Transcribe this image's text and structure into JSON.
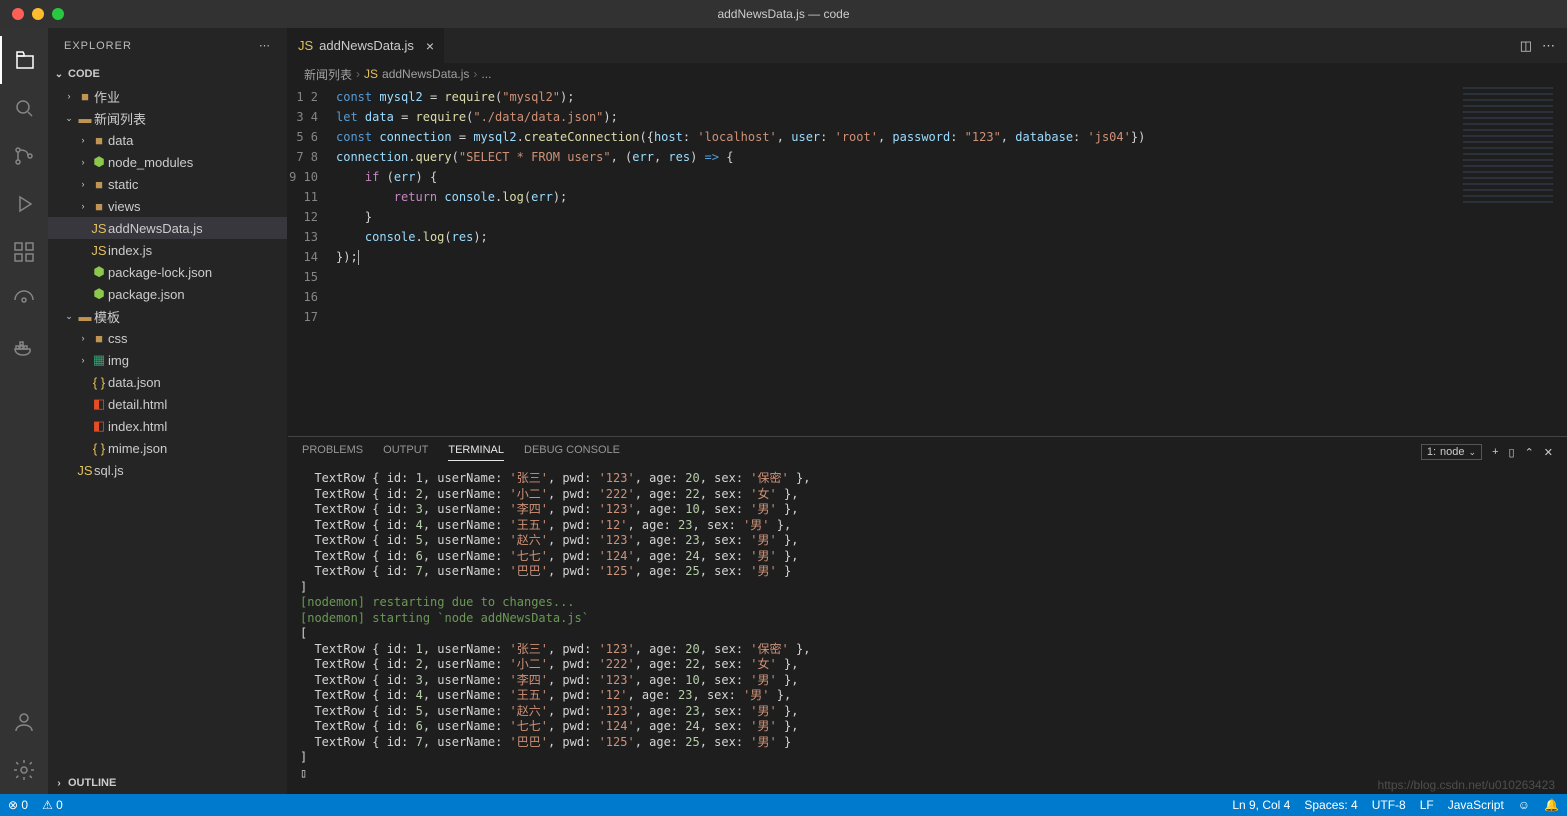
{
  "window": {
    "title": "addNewsData.js — code"
  },
  "sidebar": {
    "title": "EXPLORER",
    "section_code": "CODE",
    "outline": "OUTLINE",
    "tree": [
      {
        "indent": 1,
        "chev": "r",
        "icon": "folder",
        "label": "作业"
      },
      {
        "indent": 1,
        "chev": "d",
        "icon": "folder-open",
        "label": "新闻列表"
      },
      {
        "indent": 2,
        "chev": "r",
        "icon": "folder",
        "label": "data"
      },
      {
        "indent": 2,
        "chev": "r",
        "icon": "npm",
        "label": "node_modules"
      },
      {
        "indent": 2,
        "chev": "r",
        "icon": "folder",
        "label": "static"
      },
      {
        "indent": 2,
        "chev": "r",
        "icon": "folder",
        "label": "views"
      },
      {
        "indent": 2,
        "chev": "n",
        "icon": "js",
        "label": "addNewsData.js",
        "selected": true
      },
      {
        "indent": 2,
        "chev": "n",
        "icon": "js",
        "label": "index.js"
      },
      {
        "indent": 2,
        "chev": "n",
        "icon": "npm",
        "label": "package-lock.json"
      },
      {
        "indent": 2,
        "chev": "n",
        "icon": "npm",
        "label": "package.json"
      },
      {
        "indent": 1,
        "chev": "d",
        "icon": "folder-open",
        "label": "模板"
      },
      {
        "indent": 2,
        "chev": "r",
        "icon": "folder",
        "label": "css"
      },
      {
        "indent": 2,
        "chev": "r",
        "icon": "img",
        "label": "img"
      },
      {
        "indent": 2,
        "chev": "n",
        "icon": "json",
        "label": "data.json"
      },
      {
        "indent": 2,
        "chev": "n",
        "icon": "html",
        "label": "detail.html"
      },
      {
        "indent": 2,
        "chev": "n",
        "icon": "html",
        "label": "index.html"
      },
      {
        "indent": 2,
        "chev": "n",
        "icon": "json",
        "label": "mime.json"
      },
      {
        "indent": 1,
        "chev": "n",
        "icon": "js",
        "label": "sql.js"
      }
    ]
  },
  "tabs": {
    "open": [
      {
        "icon": "js",
        "label": "addNewsData.js"
      }
    ]
  },
  "breadcrumbs": {
    "items": [
      "新闻列表",
      "addNewsData.js",
      "..."
    ]
  },
  "editor": {
    "line_count": 17
  },
  "code": {
    "kw_const": "const",
    "kw_let": "let",
    "kw_if": "if",
    "kw_return": "return",
    "id_mysql2": "mysql2",
    "id_data": "data",
    "id_connection": "connection",
    "id_err": "err",
    "id_res": "res",
    "id_console": "console",
    "fn_require": "require",
    "fn_createConnection": "createConnection",
    "fn_query": "query",
    "fn_log": "log",
    "str_mysql2": "\"mysql2\"",
    "str_datajson": "\"./data/data.json\"",
    "str_select": "\"SELECT * FROM users\"",
    "str_localhost": "'localhost'",
    "str_root": "'root'",
    "str_123": "\"123\"",
    "str_js04": "'js04'",
    "prop_host": "host",
    "prop_user": "user",
    "prop_password": "password",
    "prop_database": "database"
  },
  "panel": {
    "tabs": {
      "problems": "PROBLEMS",
      "output": "OUTPUT",
      "terminal": "TERMINAL",
      "debug": "DEBUG CONSOLE"
    },
    "shell": "node"
  },
  "terminal": {
    "rows1": [
      {
        "id": 1,
        "userName": "张三",
        "pwd": "123",
        "age": 20,
        "sex": "保密",
        "comma": true
      },
      {
        "id": 2,
        "userName": "小二",
        "pwd": "222",
        "age": 22,
        "sex": "女",
        "comma": true
      },
      {
        "id": 3,
        "userName": "李四",
        "pwd": "123",
        "age": 10,
        "sex": "男",
        "comma": true
      },
      {
        "id": 4,
        "userName": "王五",
        "pwd": "12",
        "age": 23,
        "sex": "男",
        "comma": true
      },
      {
        "id": 5,
        "userName": "赵六",
        "pwd": "123",
        "age": 23,
        "sex": "男",
        "comma": true
      },
      {
        "id": 6,
        "userName": "七七",
        "pwd": "124",
        "age": 24,
        "sex": "男",
        "comma": true
      },
      {
        "id": 7,
        "userName": "巴巴",
        "pwd": "125",
        "age": 25,
        "sex": "男",
        "comma": false
      }
    ],
    "close1": "]",
    "nodemon_restart": "[nodemon] restarting due to changes...",
    "nodemon_start": "[nodemon] starting `node addNewsData.js`",
    "open2": "[",
    "rows2": [
      {
        "id": 1,
        "userName": "张三",
        "pwd": "123",
        "age": 20,
        "sex": "保密",
        "comma": true
      },
      {
        "id": 2,
        "userName": "小二",
        "pwd": "222",
        "age": 22,
        "sex": "女",
        "comma": true
      },
      {
        "id": 3,
        "userName": "李四",
        "pwd": "123",
        "age": 10,
        "sex": "男",
        "comma": true
      },
      {
        "id": 4,
        "userName": "王五",
        "pwd": "12",
        "age": 23,
        "sex": "男",
        "comma": true
      },
      {
        "id": 5,
        "userName": "赵六",
        "pwd": "123",
        "age": 23,
        "sex": "男",
        "comma": true
      },
      {
        "id": 6,
        "userName": "七七",
        "pwd": "124",
        "age": 24,
        "sex": "男",
        "comma": true
      },
      {
        "id": 7,
        "userName": "巴巴",
        "pwd": "125",
        "age": 25,
        "sex": "男",
        "comma": false
      }
    ],
    "close2": "]",
    "cursor": "▯"
  },
  "statusbar": {
    "errors": "⊗ 0",
    "warnings": "⚠ 0",
    "lncol": "Ln 9, Col 4",
    "spaces": "Spaces: 4",
    "encoding": "UTF-8",
    "eol": "LF",
    "language": "JavaScript"
  },
  "watermark": "https://blog.csdn.net/u010263423"
}
